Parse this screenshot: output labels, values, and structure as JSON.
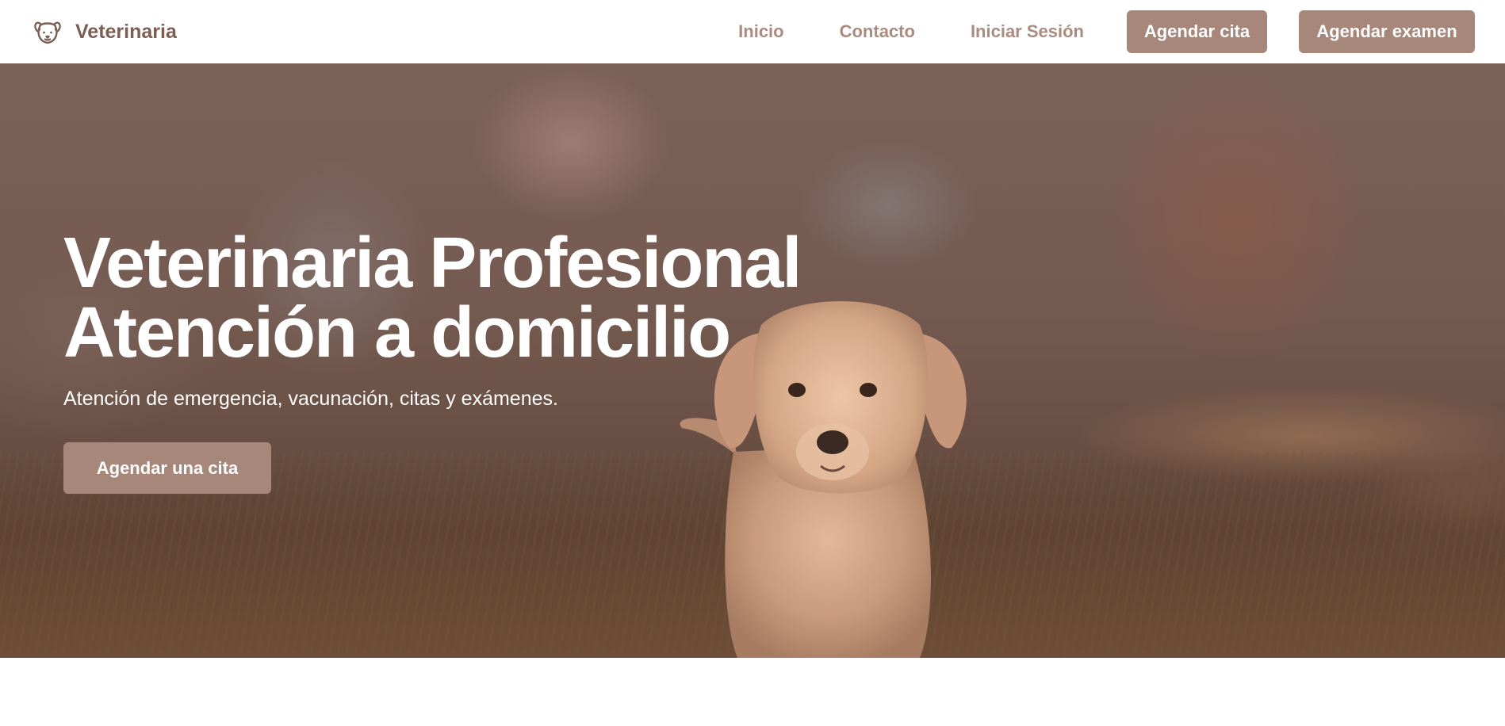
{
  "navbar": {
    "brand": {
      "icon": "dog-face-icon",
      "name": "Veterinaria"
    },
    "links": [
      {
        "label": "Inicio"
      },
      {
        "label": "Contacto"
      },
      {
        "label": "Iniciar Sesión"
      }
    ],
    "buttons": [
      {
        "label": "Agendar cita"
      },
      {
        "label": "Agendar examen"
      }
    ]
  },
  "hero": {
    "title_line1": "Veterinaria Profesional",
    "title_line2": "Atención a domicilio",
    "subtitle": "Atención de emergencia, vacunación, citas y exámenes.",
    "cta_label": "Agendar una cita",
    "background_image": "golden-retriever-puppy-photo"
  },
  "colors": {
    "accent": "#a6877a",
    "brand_text": "#7b5e54",
    "nav_link": "#a98b80",
    "hero_text": "#ffffff"
  }
}
